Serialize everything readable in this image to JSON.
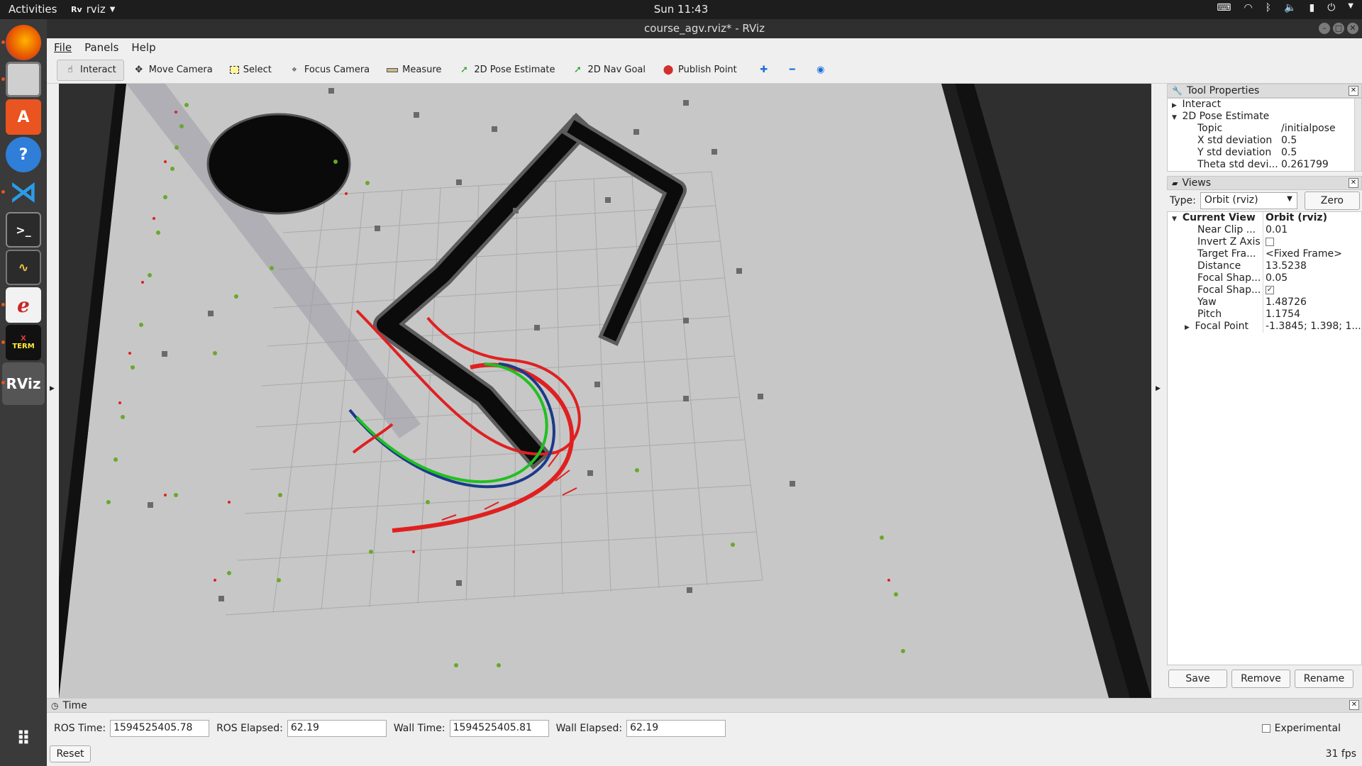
{
  "system_bar": {
    "activities": "Activities",
    "app_name": "rviz",
    "clock": "Sun 11:43"
  },
  "dock": {
    "apps": [
      "firefox",
      "files",
      "software",
      "help",
      "vscode",
      "terminal",
      "system-monitor",
      "document-viewer",
      "xterm",
      "rviz"
    ],
    "xterm_label_top": "X",
    "xterm_label_bottom": "TERM",
    "rviz_label": "RViz"
  },
  "window": {
    "title": "course_agv.rviz* - RViz"
  },
  "menu": {
    "file": "File",
    "panels": "Panels",
    "help": "Help"
  },
  "toolbar": {
    "interact": "Interact",
    "move_camera": "Move Camera",
    "select": "Select",
    "focus_camera": "Focus Camera",
    "measure": "Measure",
    "pose_estimate": "2D Pose Estimate",
    "nav_goal": "2D Nav Goal",
    "publish_point": "Publish Point"
  },
  "tool_properties": {
    "title": "Tool Properties",
    "interact": "Interact",
    "pose_estimate": "2D Pose Estimate",
    "rows": [
      {
        "key": "Topic",
        "value": "/initialpose"
      },
      {
        "key": "X std deviation",
        "value": "0.5"
      },
      {
        "key": "Y std deviation",
        "value": "0.5"
      },
      {
        "key": "Theta std devi...",
        "value": "0.261799"
      }
    ]
  },
  "views": {
    "title": "Views",
    "type_label": "Type:",
    "type_value": "Orbit (rviz)",
    "zero_button": "Zero",
    "current_view": "Current View",
    "current_view_value": "Orbit (rviz)",
    "rows": [
      {
        "key": "Near Clip ...",
        "value": "0.01"
      },
      {
        "key": "Invert Z Axis",
        "value": ""
      },
      {
        "key": "Target Fra...",
        "value": "<Fixed Frame>"
      },
      {
        "key": "Distance",
        "value": "13.5238"
      },
      {
        "key": "Focal Shap...",
        "value": "0.05"
      },
      {
        "key": "Focal Shap...",
        "value": "✓"
      },
      {
        "key": "Yaw",
        "value": "1.48726"
      },
      {
        "key": "Pitch",
        "value": "1.1754"
      },
      {
        "key": "Focal Point",
        "value": "-1.3845; 1.398; 1..."
      }
    ],
    "save": "Save",
    "remove": "Remove",
    "rename": "Rename"
  },
  "time": {
    "title": "Time",
    "ros_time_label": "ROS Time:",
    "ros_time": "1594525405.78",
    "ros_elapsed_label": "ROS Elapsed:",
    "ros_elapsed": "62.19",
    "wall_time_label": "Wall Time:",
    "wall_time": "1594525405.81",
    "wall_elapsed_label": "Wall Elapsed:",
    "wall_elapsed": "62.19",
    "experimental": "Experimental",
    "reset": "Reset",
    "fps": "31 fps"
  }
}
